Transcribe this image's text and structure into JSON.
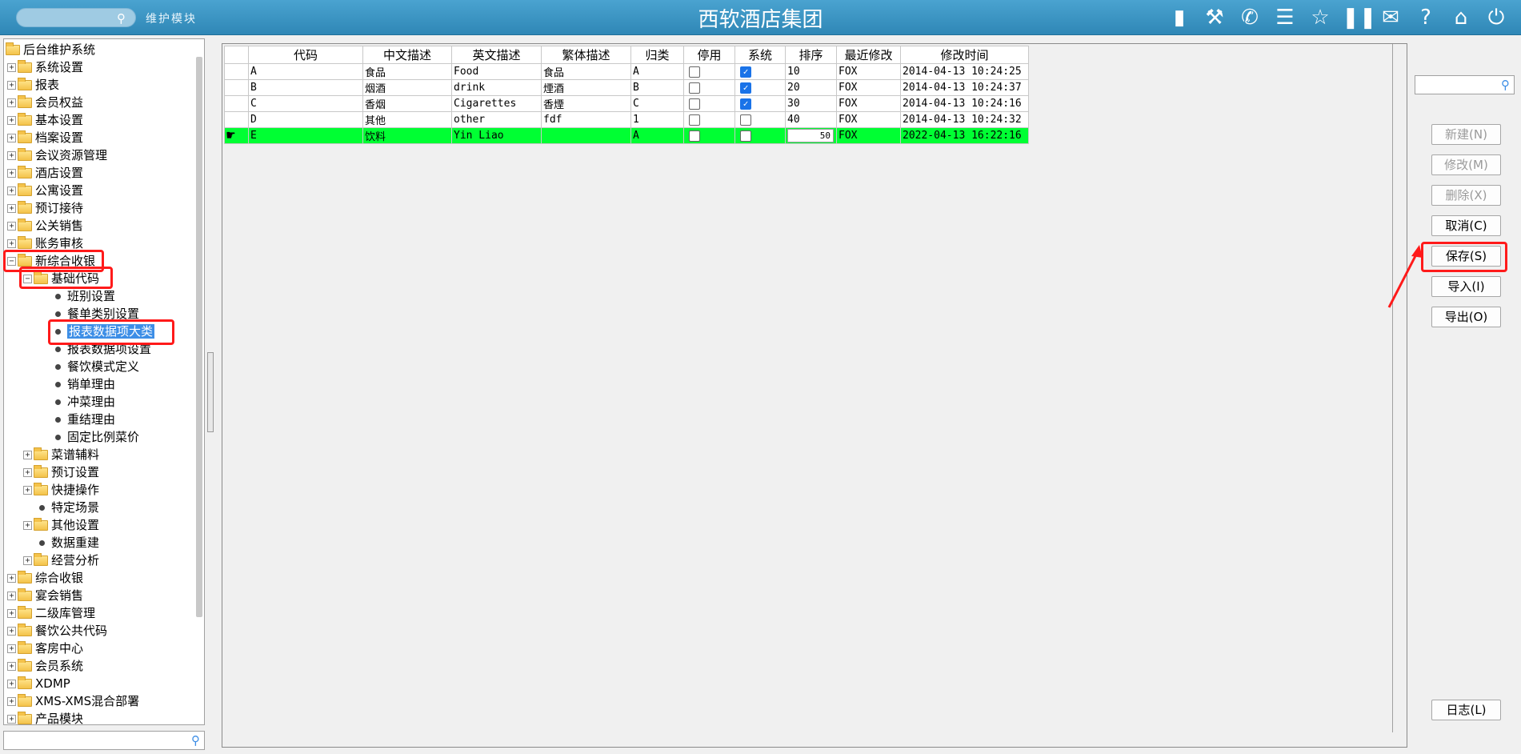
{
  "header": {
    "search_icon": "search-icon",
    "module_label": "维护模块",
    "title": "西软酒店集团",
    "icons": [
      "signal-icon",
      "tools-icon",
      "phone-icon",
      "menu-icon",
      "star-icon",
      "columns-icon",
      "mail-icon",
      "help-icon",
      "home-icon",
      "power-icon"
    ]
  },
  "tree": {
    "root": "后台维护系统",
    "items": [
      {
        "label": "系统设置"
      },
      {
        "label": "报表"
      },
      {
        "label": "会员权益"
      },
      {
        "label": "基本设置"
      },
      {
        "label": "档案设置"
      },
      {
        "label": "会议资源管理"
      },
      {
        "label": "酒店设置"
      },
      {
        "label": "公寓设置"
      },
      {
        "label": "预订接待"
      },
      {
        "label": "公关销售"
      },
      {
        "label": "账务审核"
      },
      {
        "label": "新综合收银"
      }
    ],
    "sub_folder": "基础代码",
    "leaves": [
      "班别设置",
      "餐单类别设置",
      "报表数据项大类",
      "报表数据项设置",
      "餐饮模式定义",
      "销单理由",
      "冲菜理由",
      "重结理由",
      "固定比例菜价"
    ],
    "sub_items": [
      {
        "label": "菜谱辅料",
        "type": "folder"
      },
      {
        "label": "预订设置",
        "type": "folder"
      },
      {
        "label": "快捷操作",
        "type": "folder"
      },
      {
        "label": "特定场景",
        "type": "leaf"
      },
      {
        "label": "其他设置",
        "type": "folder"
      },
      {
        "label": "数据重建",
        "type": "leaf"
      },
      {
        "label": "经营分析",
        "type": "folder"
      }
    ],
    "bottom_items": [
      {
        "label": "综合收银"
      },
      {
        "label": "宴会销售"
      },
      {
        "label": "二级库管理"
      },
      {
        "label": "餐饮公共代码"
      },
      {
        "label": "客房中心"
      },
      {
        "label": "会员系统"
      },
      {
        "label": "XDMP"
      },
      {
        "label": "XMS-XMS混合部署"
      },
      {
        "label": "产品模块"
      }
    ]
  },
  "grid": {
    "headers": [
      "代码",
      "中文描述",
      "英文描述",
      "繁体描述",
      "归类",
      "停用",
      "系统",
      "排序",
      "最近修改",
      "修改时间"
    ],
    "rows": [
      {
        "code": "A",
        "cn": "食品",
        "en": "Food",
        "tw": "食品",
        "cat": "A",
        "disabled": false,
        "system": true,
        "order": "10",
        "modifier": "FOX",
        "time": "2014-04-13 10:24:25"
      },
      {
        "code": "B",
        "cn": "烟酒",
        "en": "drink",
        "tw": "煙酒",
        "cat": "B",
        "disabled": false,
        "system": true,
        "order": "20",
        "modifier": "FOX",
        "time": "2014-04-13 10:24:37"
      },
      {
        "code": "C",
        "cn": "香烟",
        "en": "Cigarettes",
        "tw": "香煙",
        "cat": "C",
        "disabled": false,
        "system": true,
        "order": "30",
        "modifier": "FOX",
        "time": "2014-04-13 10:24:16"
      },
      {
        "code": "D",
        "cn": "其他",
        "en": "other",
        "tw": "fdf",
        "cat": "1",
        "disabled": false,
        "system": false,
        "order": "40",
        "modifier": "FOX",
        "time": "2014-04-13 10:24:32"
      },
      {
        "code": "E",
        "cn": "饮料",
        "en": "Yin Liao",
        "tw": "",
        "cat": "A",
        "disabled": false,
        "system": false,
        "order": "50",
        "modifier": "FOX",
        "time": "2022-04-13 16:22:16"
      }
    ]
  },
  "buttons": {
    "new": "新建(N)",
    "edit": "修改(M)",
    "delete": "删除(X)",
    "cancel": "取消(C)",
    "save": "保存(S)",
    "import": "导入(I)",
    "export": "导出(O)",
    "log": "日志(L)"
  }
}
